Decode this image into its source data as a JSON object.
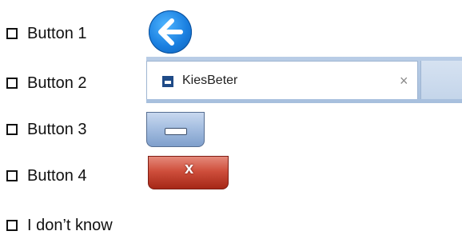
{
  "options": [
    {
      "label": "Button 1"
    },
    {
      "label": "Button 2"
    },
    {
      "label": "Button 3"
    },
    {
      "label": "Button 4"
    },
    {
      "label": "I don’t know"
    }
  ],
  "tab": {
    "title": "KiesBeter",
    "close_glyph": "×"
  },
  "close_button": {
    "glyph": "x"
  },
  "icons": {
    "back": "arrow-left-icon",
    "favicon": "kiesbeter-favicon-icon",
    "minimize": "minimize-icon",
    "close": "close-icon"
  },
  "colors": {
    "back_button": "#1a7fe0",
    "tab_strip": "#b9cde6",
    "minimize_button": "#a6bfe1",
    "close_button": "#cf4f3c"
  }
}
